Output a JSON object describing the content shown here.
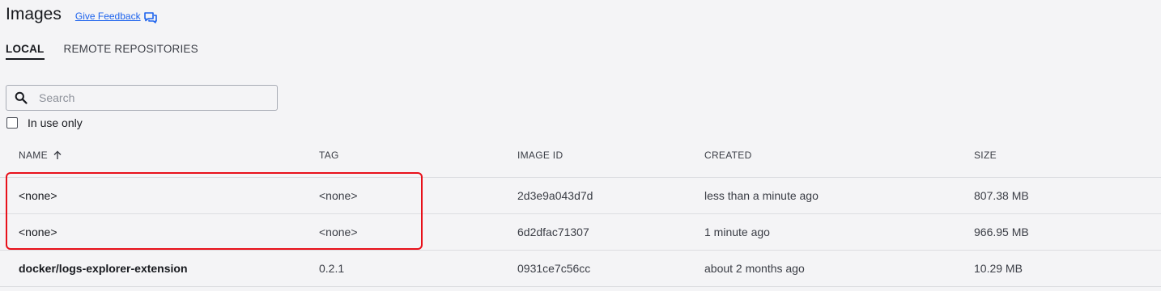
{
  "header": {
    "title": "Images",
    "feedback_label": "Give Feedback"
  },
  "tabs": [
    {
      "label": "LOCAL",
      "active": true
    },
    {
      "label": "REMOTE REPOSITORIES",
      "active": false
    }
  ],
  "search": {
    "placeholder": "Search",
    "value": ""
  },
  "filter": {
    "in_use_label": "In use only",
    "checked": false
  },
  "table": {
    "columns": [
      "NAME",
      "TAG",
      "IMAGE ID",
      "CREATED",
      "SIZE"
    ],
    "sort": {
      "column": "NAME",
      "direction": "ascending"
    },
    "rows": [
      {
        "name": "<none>",
        "tag": "<none>",
        "image_id": "2d3e9a043d7d",
        "created": "less than a minute ago",
        "size": "807.38 MB"
      },
      {
        "name": "<none>",
        "tag": "<none>",
        "image_id": "6d2dfac71307",
        "created": "1 minute ago",
        "size": "966.95 MB"
      },
      {
        "name": "docker/logs-explorer-extension",
        "tag": "0.2.1",
        "image_id": "0931ce7c56cc",
        "created": "about 2 months ago",
        "size": "10.29 MB"
      }
    ]
  },
  "colors": {
    "accent": "#1d63ed",
    "highlight": "#e8101a",
    "background": "#f4f4f6"
  },
  "icons": {
    "feedback": "chat-bubbles-icon",
    "search": "magnifier-icon",
    "sort": "arrow-up-icon"
  }
}
